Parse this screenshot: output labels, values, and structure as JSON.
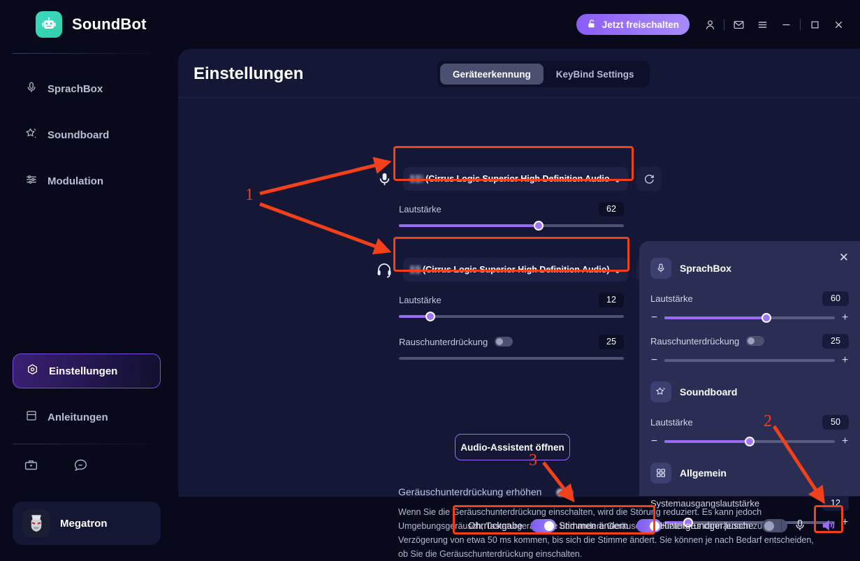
{
  "app": {
    "name": "SoundBot",
    "logo_icon": "robot-icon"
  },
  "titlebar": {
    "unlock_label": "Jetzt freischalten",
    "unlock_icon": "unlock-icon",
    "account_icon": "person-icon",
    "mail_icon": "mail-icon",
    "menu_icon": "hamburger-menu-icon",
    "minimize_icon": "minimize-icon",
    "maximize_icon": "maximize-icon",
    "close_icon": "close-icon"
  },
  "sidebar": {
    "items": [
      {
        "label": "SprachBox",
        "icon": "microphone-icon",
        "active": false
      },
      {
        "label": "Soundboard",
        "icon": "magic-star-icon",
        "active": false
      },
      {
        "label": "Modulation",
        "icon": "sliders-icon",
        "active": false
      },
      {
        "label": "Einstellungen",
        "icon": "gear-target-icon",
        "active": true
      },
      {
        "label": "Anleitungen",
        "icon": "book-icon",
        "active": false
      }
    ],
    "footer_icons": [
      {
        "name": "toolbox-icon"
      },
      {
        "name": "chat-bubble-icon"
      }
    ],
    "user": {
      "name": "Megatron",
      "avatar_icon": "megatron-avatar"
    }
  },
  "main": {
    "title": "Einstellungen",
    "tabs": [
      {
        "label": "Geräteerkennung",
        "active": true
      },
      {
        "label": "KeyBind Settings",
        "active": false
      }
    ],
    "microphone": {
      "icon": "microphone-icon",
      "device": "(Cirrus Logic Superior High Definition Audio",
      "device_prefix_blurred": true,
      "caret_icon": "chevron-down-icon",
      "refresh_icon": "refresh-icon",
      "volume_label": "Lautstärke",
      "volume_value": "62",
      "volume_percent": 62
    },
    "headphone": {
      "icon": "headphone-icon",
      "device": "(Cirrus Logic Superior High Definition Audio)",
      "device_prefix_blurred": true,
      "caret_icon": "chevron-down-icon",
      "refresh_icon": "refresh-icon",
      "volume_label": "Lautstärke",
      "volume_value": "12",
      "volume_percent": 14
    },
    "noise_suppression": {
      "label": "Rauschunterdrückung",
      "value": "25",
      "percent": 0,
      "enabled": false
    },
    "audio_assistant_button": "Audio-Assistent öffnen",
    "enhance": {
      "label": "Geräuschunterdrückung erhöhen",
      "enabled": false,
      "description": "Wenn Sie die Geräuschunterdrückung einschalten, wird die Störung reduziert. Es kann jedoch Umgebungsgeräusch, Tastaturgeräusche und andere Geräusche reduziert. Es kann jedoch zu einer Verzögerung von etwa 50 ms kommen, bis sich die Stimme ändert. Sie können je nach Bedarf entscheiden, ob Sie die Geräuschunterdrückung einschalten."
    }
  },
  "float_panel": {
    "close_icon": "close-icon",
    "sections": [
      {
        "title": "SprachBox",
        "icon": "microphone-icon",
        "controls": [
          {
            "label": "Lautstärke",
            "value": "60",
            "percent": 60,
            "type": "slider",
            "minus": "−",
            "plus": "+"
          },
          {
            "label": "Rauschunterdrückung",
            "value": "25",
            "percent": 0,
            "type": "toggle-slider",
            "enabled": false,
            "minus": "−",
            "plus": "+"
          }
        ]
      },
      {
        "title": "Soundboard",
        "icon": "magic-star-icon",
        "controls": [
          {
            "label": "Lautstärke",
            "value": "50",
            "percent": 50,
            "type": "slider",
            "minus": "−",
            "plus": "+"
          }
        ]
      },
      {
        "title": "Allgemein",
        "icon": "grid-icon",
        "controls": [
          {
            "label": "Systemausgangslautstärke",
            "value": "12",
            "percent": 14,
            "type": "slider",
            "minus": "−",
            "plus": "+"
          }
        ]
      }
    ]
  },
  "bottombar": {
    "ear_return": {
      "label": "Ohrrückgabe",
      "enabled": true
    },
    "voice_change": {
      "label": "Stimmen ändern",
      "enabled": true
    },
    "background_sound": {
      "label": "Hintergrundgeräusche",
      "enabled": false
    },
    "mic_icon": "microphone-icon",
    "speaker_icon": "speaker-wave-icon"
  },
  "annotations": {
    "accent": "#f2401b",
    "markers": [
      {
        "number": "1"
      },
      {
        "number": "2"
      },
      {
        "number": "3"
      }
    ]
  }
}
